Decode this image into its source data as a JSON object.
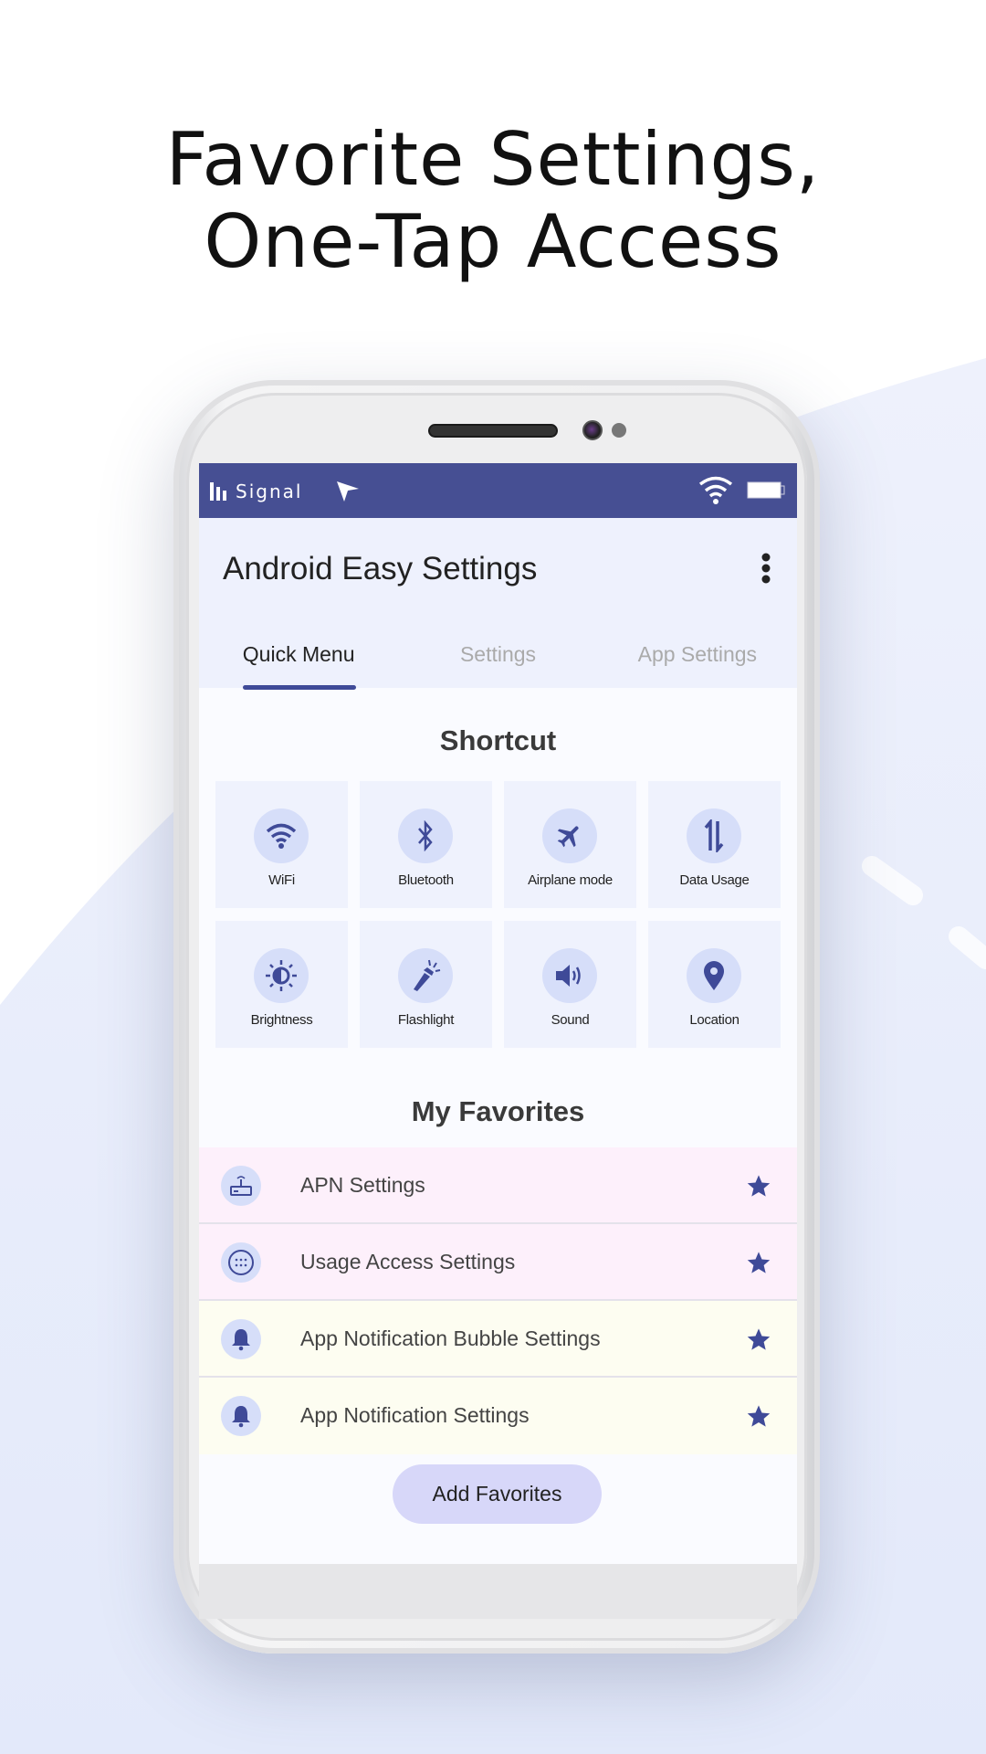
{
  "headline": {
    "line1": "Favorite Settings,",
    "line2": "One-Tap Access"
  },
  "colors": {
    "accent": "#464f93",
    "icon": "#3f4a98",
    "tile": "#eff2fd",
    "icon_bg": "#d6def9",
    "row_pink": "#fdf0fb",
    "row_yellow": "#fdfdf1",
    "button": "#d7d7f9"
  },
  "status_bar": {
    "carrier": "Signal",
    "icons": [
      "signal-bars-icon",
      "location-arrow-icon",
      "wifi-icon",
      "battery-icon"
    ]
  },
  "app": {
    "title": "Android Easy Settings",
    "menu_icon": "more-vert-icon"
  },
  "tabs": [
    {
      "label": "Quick Menu",
      "active": true
    },
    {
      "label": "Settings",
      "active": false
    },
    {
      "label": "App Settings",
      "active": false
    }
  ],
  "shortcut": {
    "heading": "Shortcut",
    "items": [
      {
        "label": "WiFi",
        "icon": "wifi-icon"
      },
      {
        "label": "Bluetooth",
        "icon": "bluetooth-icon"
      },
      {
        "label": "Airplane mode",
        "icon": "airplane-icon"
      },
      {
        "label": "Data Usage",
        "icon": "data-usage-icon"
      },
      {
        "label": "Brightness",
        "icon": "brightness-icon"
      },
      {
        "label": "Flashlight",
        "icon": "flashlight-icon"
      },
      {
        "label": "Sound",
        "icon": "sound-icon"
      },
      {
        "label": "Location",
        "icon": "location-icon"
      }
    ]
  },
  "favorites": {
    "heading": "My Favorites",
    "items": [
      {
        "label": "APN Settings",
        "icon": "router-icon",
        "starred": true
      },
      {
        "label": "Usage Access Settings",
        "icon": "apps-icon",
        "starred": true
      },
      {
        "label": "App Notification Bubble Settings",
        "icon": "bell-icon",
        "starred": true
      },
      {
        "label": "App Notification Settings",
        "icon": "bell-icon",
        "starred": true
      }
    ],
    "add_button": "Add Favorites"
  }
}
